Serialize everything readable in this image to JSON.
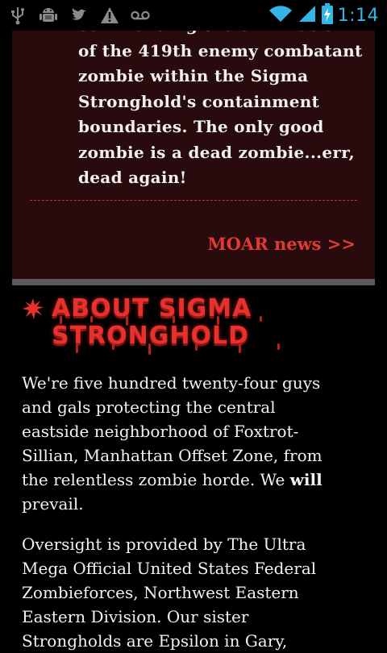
{
  "status_bar": {
    "time": "1:14",
    "left_icons": [
      "usb-icon",
      "android-debug-icon",
      "twitter-icon",
      "warning-icon",
      "voicemail-icon"
    ],
    "right_icons": [
      "wifi-icon",
      "signal-icon",
      "battery-charging-icon"
    ],
    "clock_color": "#33b5e5"
  },
  "news": {
    "lines": [
      "commending the elimination",
      "of the 419th enemy combatant",
      "zombie within the Sigma",
      "Stronghold's containment",
      "boundaries. The only good",
      "zombie is a dead zombie...err,",
      "dead again!"
    ],
    "more_link": "MOAR news >>"
  },
  "about": {
    "title_line1": "ABOUT SIGMA",
    "title_line2": "STRONGHOLD",
    "p1_lines": [
      "We're five hundred twenty-four guys",
      "and gals protecting the central",
      "eastside neighborhood of Foxtrot-",
      "Sillian, Manhattan Offset Zone, from",
      "the relentless zombie horde. We "
    ],
    "p1_emph": "will",
    "p1_last": "prevail.",
    "p2_lines": [
      "Oversight is provided by The Ultra",
      "Mega Official United States Federal",
      "Zombieforces, Northwest Eastern",
      "Eastern Division. Our sister",
      "Strongholds are Epsilon in Gary,"
    ]
  },
  "colors": {
    "accent_red": "#e8302c",
    "card_bg": "#2a0b0d",
    "bar_gray": "#5a5a5a"
  }
}
